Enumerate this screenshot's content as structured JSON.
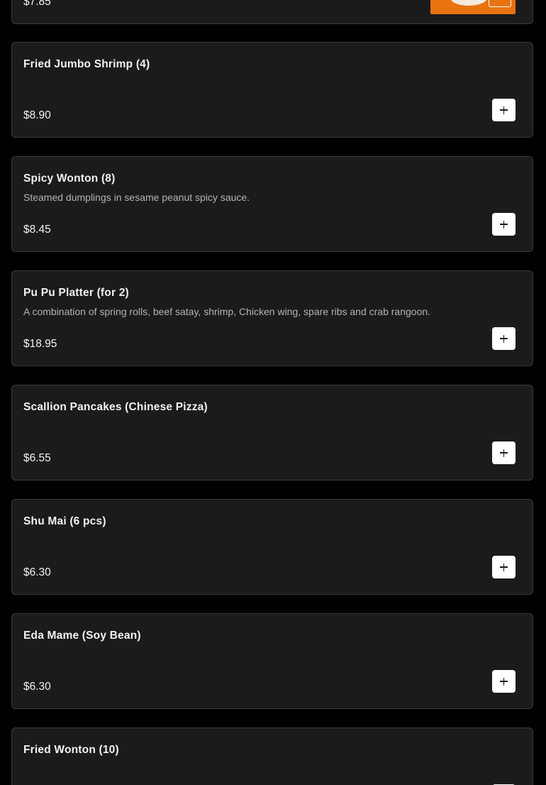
{
  "menu": {
    "partial_item": {
      "price": "$7.85"
    },
    "items": [
      {
        "name": "Fried Jumbo Shrimp (4)",
        "description": "",
        "price": "$8.90"
      },
      {
        "name": "Spicy Wonton (8)",
        "description": "Steamed dumplings in sesame peanut spicy sauce.",
        "price": "$8.45"
      },
      {
        "name": "Pu Pu Platter (for 2)",
        "description": "A combination of spring rolls, beef satay, shrimp, Chicken wing, spare ribs and crab rangoon.",
        "price": "$18.95"
      },
      {
        "name": "Scallion Pancakes (Chinese Pizza)",
        "description": "",
        "price": "$6.55"
      },
      {
        "name": "Shu Mai (6 pcs)",
        "description": "",
        "price": "$6.30"
      },
      {
        "name": "Eda Mame (Soy Bean)",
        "description": "",
        "price": "$6.30"
      },
      {
        "name": "Fried Wonton (10)",
        "description": "",
        "price": ""
      }
    ],
    "add_button_icon": "plus-icon"
  },
  "colors": {
    "page_background": "#000000",
    "card_background": "#1b1b1b",
    "card_border": "#3a3a3a",
    "text_primary": "#f2f2f2",
    "text_secondary": "#b3b3b3",
    "button_background": "#ffffff",
    "image_accent": "#e8730f"
  }
}
